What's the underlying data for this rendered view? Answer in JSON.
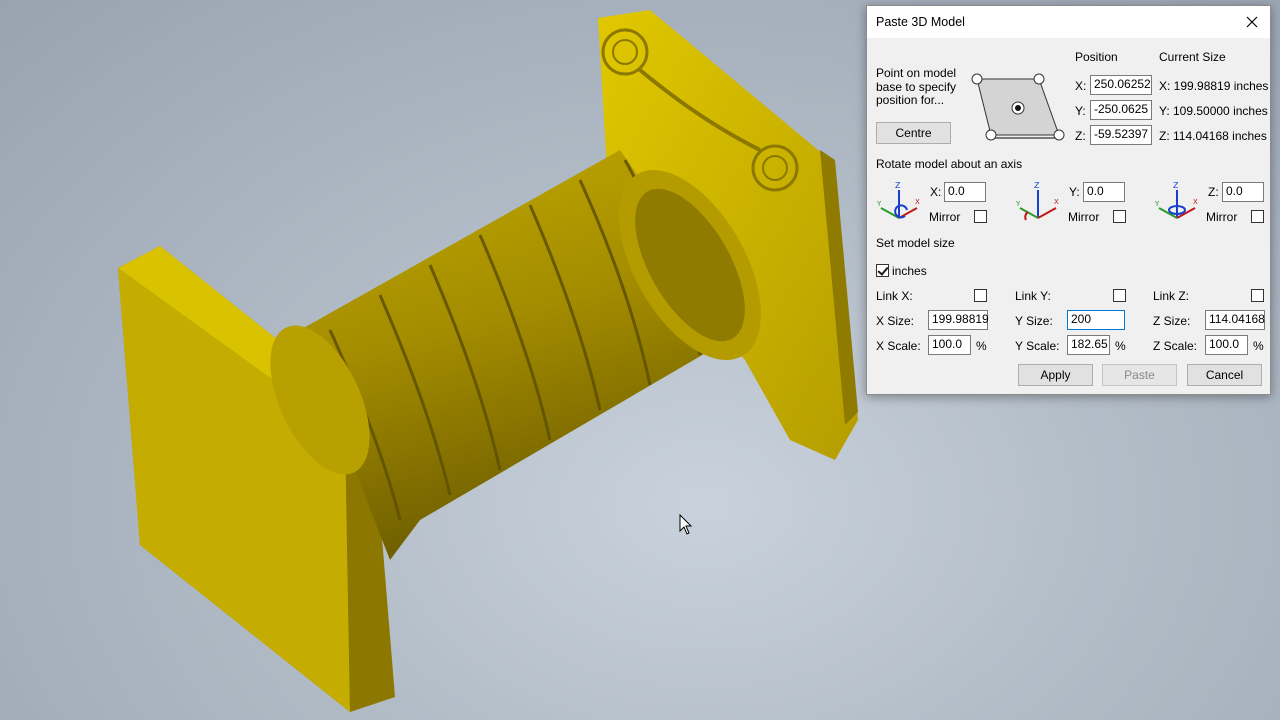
{
  "dialog": {
    "title": "Paste 3D Model",
    "point_hint": "Point on model base to specify position for...",
    "centre_label": "Centre",
    "position_heading": "Position",
    "current_size_heading": "Current Size",
    "position": {
      "x_label": "X:",
      "x_value": "250.06252",
      "y_label": "Y:",
      "y_value": "-250.0625",
      "z_label": "Z:",
      "z_value": "-59.52397"
    },
    "current_size": {
      "x": "X:  199.98819 inches",
      "y": "Y:  109.50000 inches",
      "z": "Z:  114.04168 inches"
    },
    "rotate_heading": "Rotate model about an axis",
    "rotate": {
      "x_label": "X:",
      "x_value": "0.0",
      "y_label": "Y:",
      "y_value": "0.0",
      "z_label": "Z:",
      "z_value": "0.0",
      "mirror_label": "Mirror"
    },
    "set_size_heading": "Set model size",
    "inches_label": "inches",
    "link": {
      "x": "Link X:",
      "y": "Link Y:",
      "z": "Link Z:"
    },
    "size": {
      "x_label": "X Size:",
      "x_value": "199.98819",
      "y_label": "Y Size:",
      "y_value": "200",
      "z_label": "Z Size:",
      "z_value": "114.04168"
    },
    "scale": {
      "x_label": "X Scale:",
      "x_value": "100.0",
      "y_label": "Y Scale:",
      "y_value": "182.65",
      "z_label": "Z Scale:",
      "z_value": "100.0",
      "unit": "%"
    },
    "buttons": {
      "apply": "Apply",
      "paste": "Paste",
      "cancel": "Cancel"
    },
    "inches_checked": true,
    "accent_color": "#0078d7"
  },
  "model": {
    "color": "#c8b000",
    "icon": "column-3d-model"
  },
  "cursor": {
    "icon": "mouse-pointer-icon"
  }
}
